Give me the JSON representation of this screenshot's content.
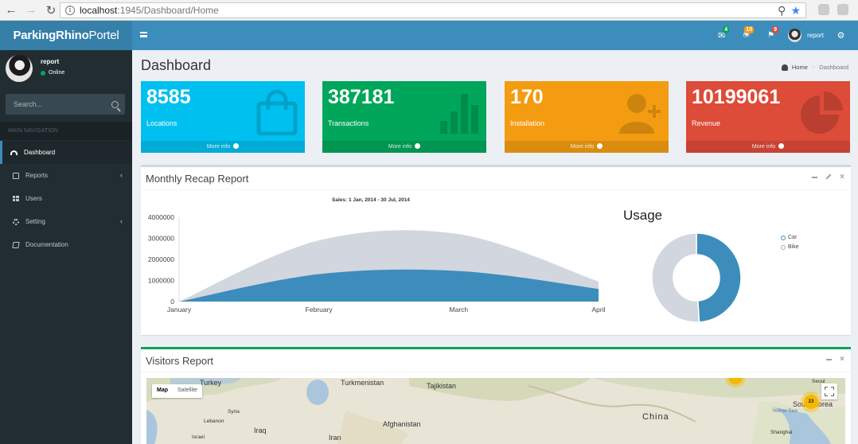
{
  "browser": {
    "url_host": "localhost",
    "url_path": ":1945/Dashboard/Home"
  },
  "header": {
    "logo_bold": "ParkingRhino",
    "logo_rest": "Portel",
    "messages_count": "4",
    "notifications_count": "10",
    "tasks_count": "9",
    "user_name": "report"
  },
  "sidebar": {
    "user_name": "report",
    "user_status": "Online",
    "search_placeholder": "Search...",
    "section_header": "MAIN NAVIGATION",
    "items": [
      {
        "label": "Dashboard",
        "icon": "dashboard-icon",
        "active": true
      },
      {
        "label": "Reports",
        "icon": "reports-icon",
        "has_submenu": true
      },
      {
        "label": "Users",
        "icon": "users-icon"
      },
      {
        "label": "Setting",
        "icon": "setting-icon",
        "has_submenu": true
      },
      {
        "label": "Documentation",
        "icon": "documentation-icon"
      }
    ]
  },
  "page": {
    "title": "Dashboard",
    "breadcrumb_home": "Home",
    "breadcrumb_current": "Dashboard"
  },
  "stats": [
    {
      "value": "8585",
      "label": "Locations",
      "footer": "More info",
      "color": "#00c0ef",
      "icon": "shopping-bag-icon"
    },
    {
      "value": "387181",
      "label": "Transactions",
      "footer": "More info",
      "color": "#00a65a",
      "icon": "bar-chart-icon"
    },
    {
      "value": "170",
      "label": "Installation",
      "footer": "More info",
      "color": "#f39c12",
      "icon": "user-plus-icon"
    },
    {
      "value": "10199061",
      "label": "Revenue",
      "footer": "More info",
      "color": "#dd4b39",
      "icon": "pie-chart-icon"
    }
  ],
  "monthly_box": {
    "title": "Monthly Recap Report"
  },
  "chart_data": [
    {
      "type": "area",
      "title": "Sales: 1 Jan, 2014 - 30 Jul, 2014",
      "categories": [
        "January",
        "February",
        "March",
        "April"
      ],
      "ylim": [
        0,
        4000000
      ],
      "yticks": [
        "0",
        "1000000",
        "2000000",
        "3000000",
        "4000000"
      ],
      "series": [
        {
          "values": [
            0,
            2900000,
            3200000,
            950000
          ],
          "color": "#d2d6de"
        },
        {
          "values": [
            0,
            1300000,
            1450000,
            600000
          ],
          "color": "#3c8dbc"
        }
      ]
    },
    {
      "type": "pie",
      "title": "Usage",
      "labels": [
        "Car",
        "Bike"
      ],
      "values": [
        49,
        51
      ],
      "colors": [
        "#3c8dbc",
        "#d2d6de"
      ],
      "legend": "right"
    }
  ],
  "visitors_box": {
    "title": "Visitors Report",
    "map_tab_map": "Map",
    "map_tab_satellite": "Satellite",
    "cluster_count": "23",
    "labels": [
      "Turkey",
      "Turkmenistan",
      "Tajikistan",
      "Syria",
      "Lebanon",
      "Iraq",
      "Afghanistan",
      "Israel",
      "Iran",
      "China",
      "Seoul",
      "South Korea",
      "Yellow Sea",
      "Shanghai"
    ]
  }
}
